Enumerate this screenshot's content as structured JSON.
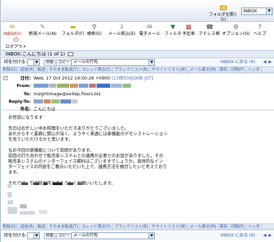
{
  "header": {
    "open_folder_label": "フォルダを開く(L)",
    "mailbox_select": "INBOX"
  },
  "toolbar": {
    "items": [
      {
        "label": "INBOX(I)",
        "icon": "inbox-icon"
      },
      {
        "label": "新規メール(N)",
        "icon": "new-mail-icon"
      },
      {
        "label": "フォルダ(F)",
        "icon": "folder-icon"
      },
      {
        "label": "検索(S)",
        "icon": "search-icon"
      },
      {
        "label": "メール取込(E)",
        "icon": "mail-import-icon"
      },
      {
        "label": "電子メール",
        "icon": "email-icon"
      },
      {
        "label": "フィルタ",
        "icon": "filter-icon"
      },
      {
        "label": "予定表",
        "icon": "calendar-icon"
      },
      {
        "label": "アドレス帳",
        "icon": "address-book-icon"
      },
      {
        "label": "オプション(O)",
        "icon": "options-icon"
      },
      {
        "label": "ヘルプ",
        "icon": "help-icon"
      }
    ],
    "logout_label": "ログアウト"
  },
  "info_bar": {
    "text": "INBOX:こんにちは (1 of 1)"
  },
  "action_bar": {
    "flag_label": "印を付ける:",
    "move_label": "移動",
    "copy_label": "コピー",
    "target_select": "メールの行先",
    "back_link": "INBOX に戻る (K)"
  },
  "link_bar": {
    "items": [
      "削除(D)",
      "返信(R)",
      "転送",
      "そのまま転送(T)",
      "スレッド表示(Y)",
      "ブラックリスト(B)",
      "ホワイトリスト(W)",
      "メール原文(M)",
      "保存",
      "印刷(P)",
      "ヘッダ"
    ]
  },
  "message": {
    "date_key": "日付:",
    "date_value": "Wed, 17 Oct 2012 19:50:26 +0900",
    "date_extra": "[11時50分26秒 JST]",
    "from_key": "From:",
    "to_key": "To:",
    "to_value": "insightimage@exitep.flxsrv.biz",
    "reply_to_key": "Reply-To:",
    "subject_key": "件名:",
    "subject_value": "こんにちは"
  },
  "body": {
    "paragraphs": [
      "お世話になります",
      "先日はお忙しい中お時間をいただきありがとうございました。\nあれからすぐ業務に関心が深く、ようやく来週には新機能のデモンストレーション\nを見ていただけるかと思います。",
      "なお今回の新機能について質問があります。\n前回の打ち合わせで販売系システムとの連携が必要とのお話がありました。その\n販売系システムのインターフェイス資料はございますでしょうか。具体的なイン\nターフェイスの内容をご教示いただいた上で、連携方法を検討したいと考えており\nます。",
      "それでは、引き続き何とぞよろしくお願いいたします。"
    ]
  },
  "bottom_action_bar": {
    "flag_label": "印を付ける:",
    "move_label": "移動",
    "copy_label": "コピー",
    "target_select": "メールの行先",
    "back_link": "INBOX に戻る (K)"
  }
}
